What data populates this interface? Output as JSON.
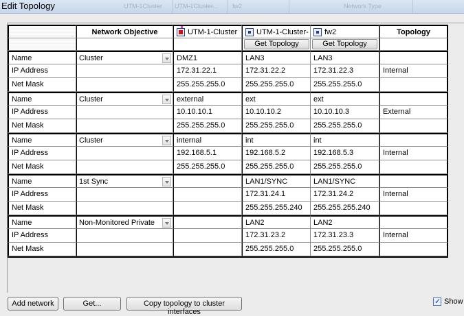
{
  "window": {
    "title": "Edit Topology",
    "ghost_labels": [
      "UTM-1Cluster",
      "UTM-1Cluster...",
      "fw2",
      "Network Type"
    ]
  },
  "header": {
    "objective_label": "Network Objective",
    "topology_label": "Topology",
    "members": [
      {
        "name": "UTM-1-Cluster",
        "icon": "cluster-icon"
      },
      {
        "name": "UTM-1-Cluster-",
        "icon": "gateway-icon"
      },
      {
        "name": "fw2",
        "icon": "gateway-icon"
      }
    ],
    "get_topology_label": "Get Topology"
  },
  "row_labels": {
    "name": "Name",
    "ip": "IP Address",
    "mask": "Net Mask"
  },
  "networks": [
    {
      "objective": "Cluster",
      "topology": "Internal",
      "cluster": {
        "name": "DMZ1",
        "ip": "172.31.22.1",
        "mask": "255.255.255.0"
      },
      "m1": {
        "name": "LAN3",
        "ip": "172.31.22.2",
        "mask": "255.255.255.0"
      },
      "m2": {
        "name": "LAN3",
        "ip": "172.31.22.3",
        "mask": "255.255.255.0"
      }
    },
    {
      "objective": "Cluster",
      "topology": "External",
      "cluster": {
        "name": "external",
        "ip": "10.10.10.1",
        "mask": "255.255.255.0"
      },
      "m1": {
        "name": "ext",
        "ip": "10.10.10.2",
        "mask": "255.255.255.0"
      },
      "m2": {
        "name": "ext",
        "ip": "10.10.10.3",
        "mask": "255.255.255.0"
      }
    },
    {
      "objective": "Cluster",
      "topology": "Internal",
      "cluster": {
        "name": "internal",
        "ip": "192.168.5.1",
        "mask": "255.255.255.0"
      },
      "m1": {
        "name": "int",
        "ip": "192.168.5.2",
        "mask": "255.255.255.0"
      },
      "m2": {
        "name": "int",
        "ip": "192.168.5.3",
        "mask": "255.255.255.0"
      }
    },
    {
      "objective": "1st Sync",
      "topology": "Internal",
      "cluster": {
        "name": "",
        "ip": "",
        "mask": ""
      },
      "m1": {
        "name": "LAN1/SYNC",
        "ip": "172.31.24.1",
        "mask": "255.255.255.240"
      },
      "m2": {
        "name": "LAN1/SYNC",
        "ip": "172.31.24.2",
        "mask": "255.255.255.240"
      }
    },
    {
      "objective": "Non-Monitored Private",
      "topology": "Internal",
      "cluster": {
        "name": "",
        "ip": "",
        "mask": ""
      },
      "m1": {
        "name": "LAN2",
        "ip": "172.31.23.2",
        "mask": "255.255.255.0"
      },
      "m2": {
        "name": "LAN2",
        "ip": "172.31.23.3",
        "mask": "255.255.255.0"
      }
    }
  ],
  "footer": {
    "add_network_label": "Add network",
    "get_label": "Get...",
    "copy_label": "Copy topology to cluster interfaces",
    "show_label": "Show",
    "show_checked": true
  }
}
